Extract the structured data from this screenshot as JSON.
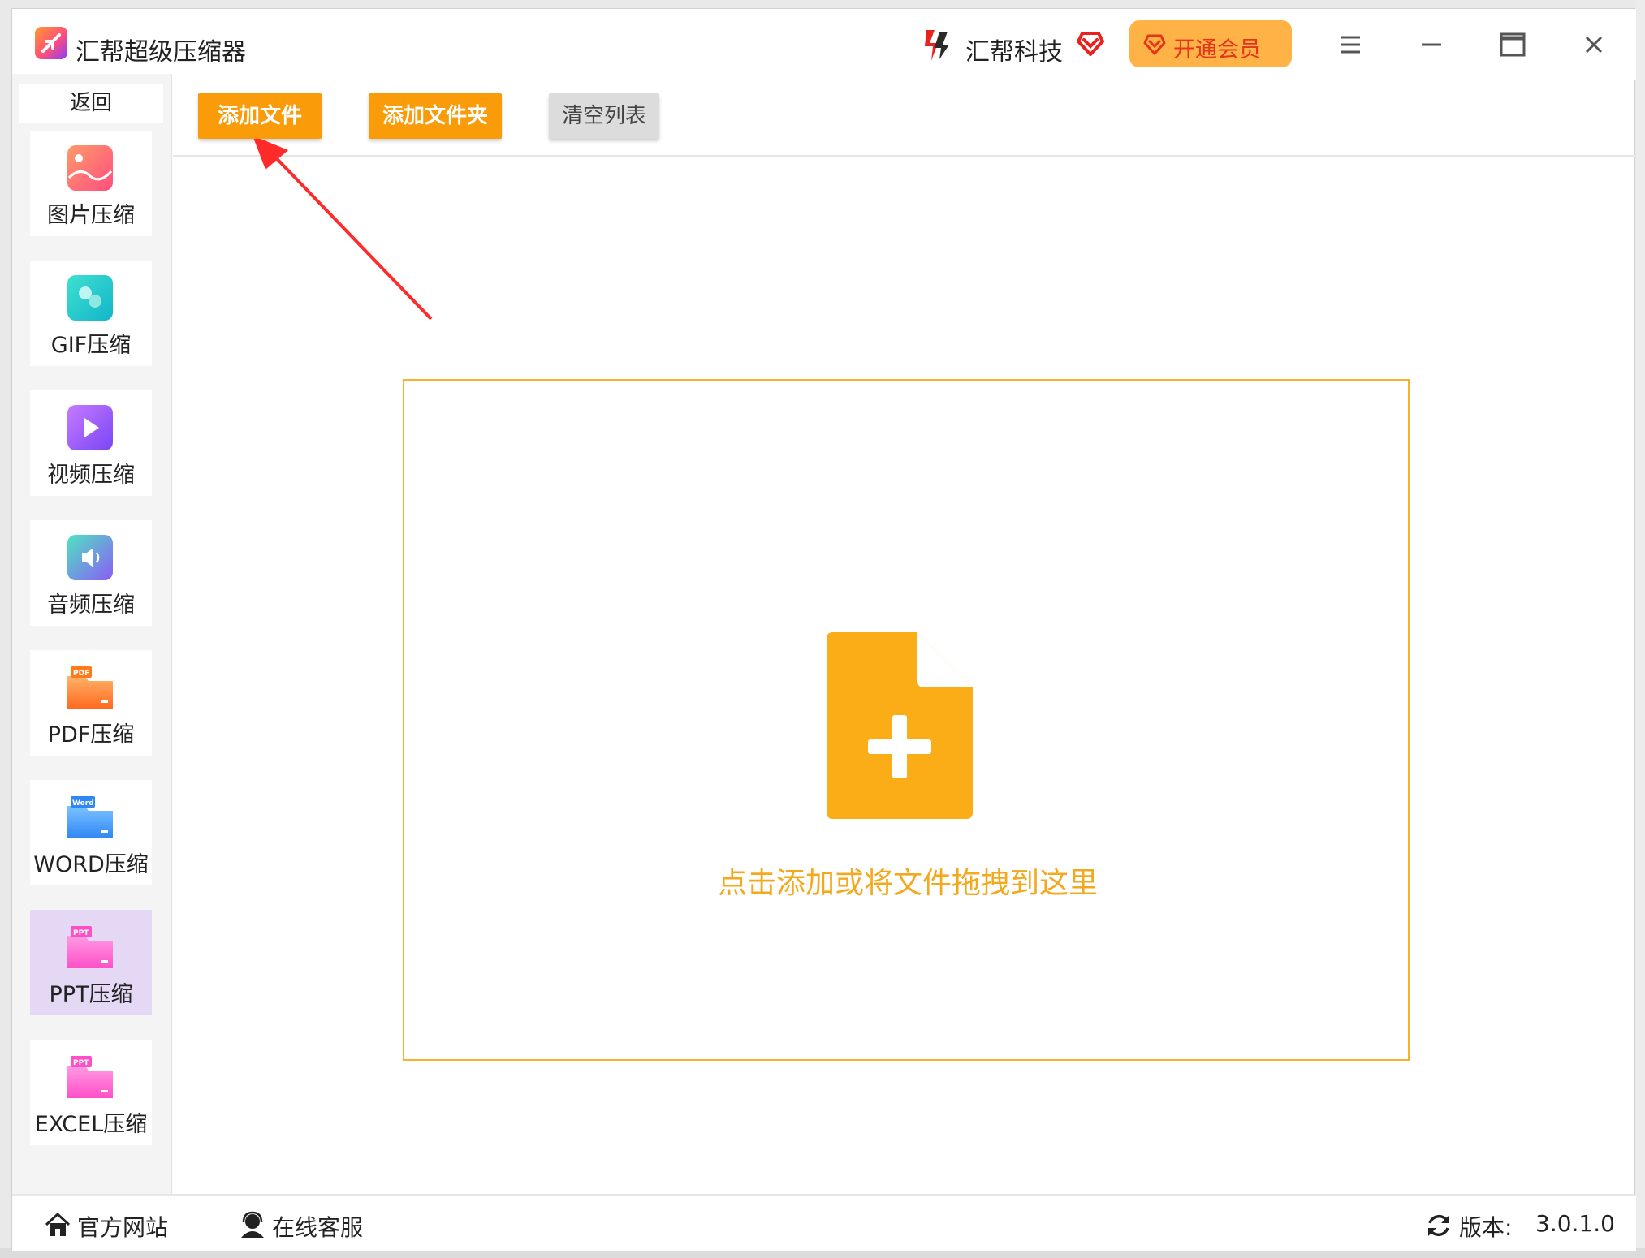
{
  "window": {
    "title": "汇帮超级压缩器",
    "brand": "汇帮科技",
    "vip_button": "开通会员",
    "controls": [
      "menu-icon",
      "minimize-icon",
      "maximize-icon",
      "close-icon"
    ]
  },
  "sidebar": {
    "back": "返回",
    "items": [
      {
        "label": "图片压缩",
        "icon": "image-compress-icon"
      },
      {
        "label": "GIF压缩",
        "icon": "gif-compress-icon"
      },
      {
        "label": "视频压缩",
        "icon": "video-compress-icon"
      },
      {
        "label": "音频压缩",
        "icon": "audio-compress-icon"
      },
      {
        "label": "PDF压缩",
        "icon": "pdf-compress-icon"
      },
      {
        "label": "WORD压缩",
        "icon": "word-compress-icon"
      },
      {
        "label": "PPT压缩",
        "icon": "ppt-compress-icon",
        "active": true
      },
      {
        "label": "EXCEL压缩",
        "icon": "excel-compress-icon"
      }
    ]
  },
  "toolbar": {
    "add_file": "添加文件",
    "add_folder": "添加文件夹",
    "clear_list": "清空列表"
  },
  "dropzone": {
    "hint": "点击添加或将文件拖拽到这里"
  },
  "statusbar": {
    "website": "官方网站",
    "support": "在线客服",
    "version_label": "版本:",
    "version": "3.0.1.0"
  },
  "colors": {
    "accent_orange": "#fa9b09",
    "drop_orange": "#f7b22a",
    "active_nav": "#e4d8f5",
    "vip_bg": "#ffb347",
    "arrow_red": "#ff2a2a"
  }
}
